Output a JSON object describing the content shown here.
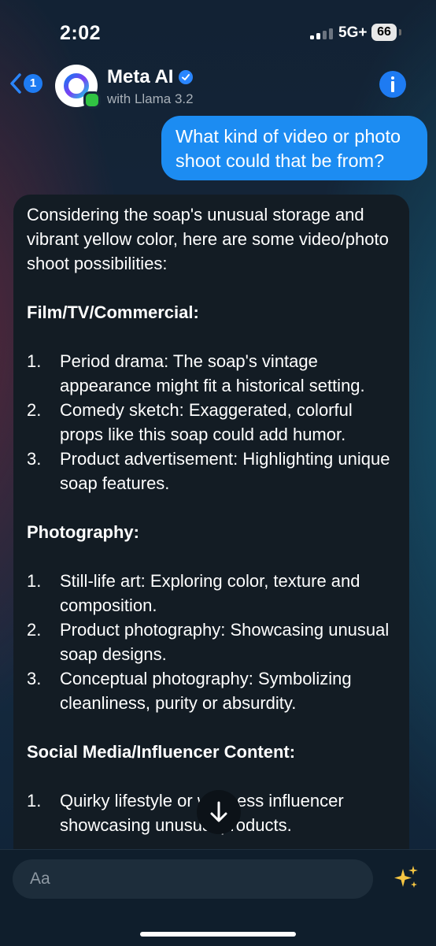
{
  "status": {
    "time": "2:02",
    "network": "5G+",
    "battery": "66"
  },
  "header": {
    "back_count": "1",
    "name": "Meta AI",
    "subtitle": "with Llama 3.2"
  },
  "messages": {
    "user": "What kind of video or photo shoot could that be from?",
    "ai": {
      "intro": "Considering the soap's unusual storage and vibrant yellow color, here are some video/photo shoot possibilities:",
      "sections": [
        {
          "heading": "Film/TV/Commercial:",
          "items": [
            {
              "num": "1.",
              "text": "Period drama: The soap's vintage appearance might fit a historical setting."
            },
            {
              "num": "2.",
              "text": "Comedy sketch: Exaggerated, colorful props like this soap could add humor."
            },
            {
              "num": "3.",
              "text": "Product advertisement: Highlighting unique soap features."
            }
          ]
        },
        {
          "heading": "Photography:",
          "items": [
            {
              "num": "1.",
              "text": "Still-life art: Exploring color, texture and composition."
            },
            {
              "num": "2.",
              "text": "Product photography: Showcasing unusual soap designs."
            },
            {
              "num": "3.",
              "text": "Conceptual photography: Symbolizing cleanliness, purity or absurdity."
            }
          ]
        },
        {
          "heading": "Social Media/Influencer Content:",
          "items": [
            {
              "num": "1.",
              "text": "Quirky lifestyle or wellness influencer showcasing unusual products."
            }
          ]
        }
      ]
    }
  },
  "composer": {
    "placeholder": "Aa"
  },
  "icons": {
    "back": "chevron-left-icon",
    "verified": "verified-badge-icon",
    "info": "info-icon",
    "scroll": "arrow-down-icon",
    "sparkle": "sparkle-icon"
  },
  "colors": {
    "accent": "#1e7bf2",
    "user_bubble": "#1c8cf2",
    "ai_bubble": "#131c24",
    "online": "#31c443"
  }
}
